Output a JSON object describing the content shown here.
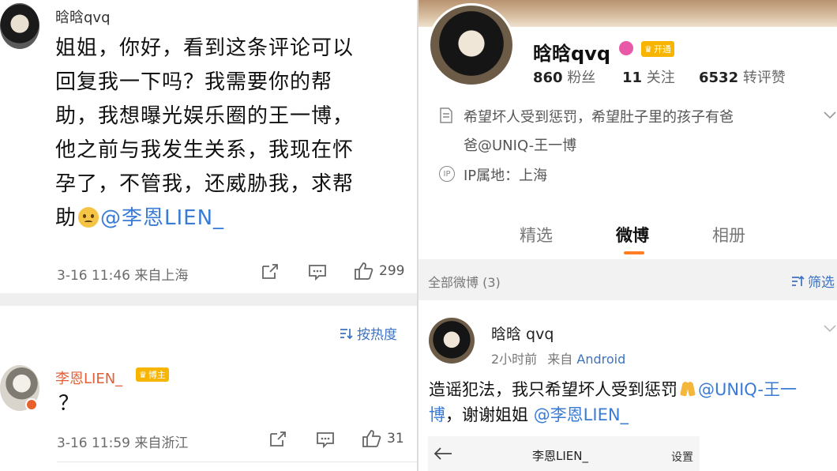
{
  "left": {
    "comment1": {
      "username": "晗晗qvq",
      "text_lines": [
        "姐姐，你好，看到这条评论可以",
        "回复我一下吗？我需要你的帮",
        "助，我想曝光娱乐圈的王一博，",
        "他之前与我发生关系，我现在怀",
        "孕了，不管我，还威胁我，求帮"
      ],
      "last_line_prefix": "助",
      "mention": "@李恩LIEN_",
      "timestamp": "3-16 11:46 来自上海",
      "like_count": "299"
    },
    "sort_label": "按热度",
    "comment2": {
      "username": "李恩LIEN_",
      "badge": "博主",
      "text": "？",
      "timestamp": "3-16 11:59 来自浙江",
      "like_count": "31"
    }
  },
  "right": {
    "profile": {
      "name": "晗晗qvq",
      "member_badge": "开通",
      "fans_count": "860",
      "fans_label": "粉丝",
      "following_count": "11",
      "following_label": "关注",
      "reposts_count": "6532",
      "reposts_label": "转评赞",
      "bio_line1": "希望坏人受到惩罚，希望肚子里的孩子有爸",
      "bio_line2": "爸@UNIQ-王一博",
      "ip_location": "IP属地：上海"
    },
    "tabs": [
      {
        "label": "精选"
      },
      {
        "label": "微博"
      },
      {
        "label": "相册"
      }
    ],
    "filter": {
      "all_label": "全部微博 (3)",
      "filter_label": "筛选"
    },
    "post": {
      "username": "晗晗 qvq",
      "time": "2小时前",
      "source_prefix": "来自",
      "source": "Android",
      "body_line1_text": "造谣犯法，我只希望坏人受到惩罚",
      "body_line1_mention": "@UNIQ-王一",
      "body_line2_mention_tail": "博",
      "body_line2_text": "，谢谢姐姐",
      "body_line2_mention": "@李恩LIEN_"
    },
    "embed": {
      "title": "李恩LIEN_",
      "settings": "设置"
    }
  },
  "colors": {
    "link": "#3a7bd5",
    "accent_orange": "#ff7f24",
    "badge_gold": "#f7b500"
  }
}
